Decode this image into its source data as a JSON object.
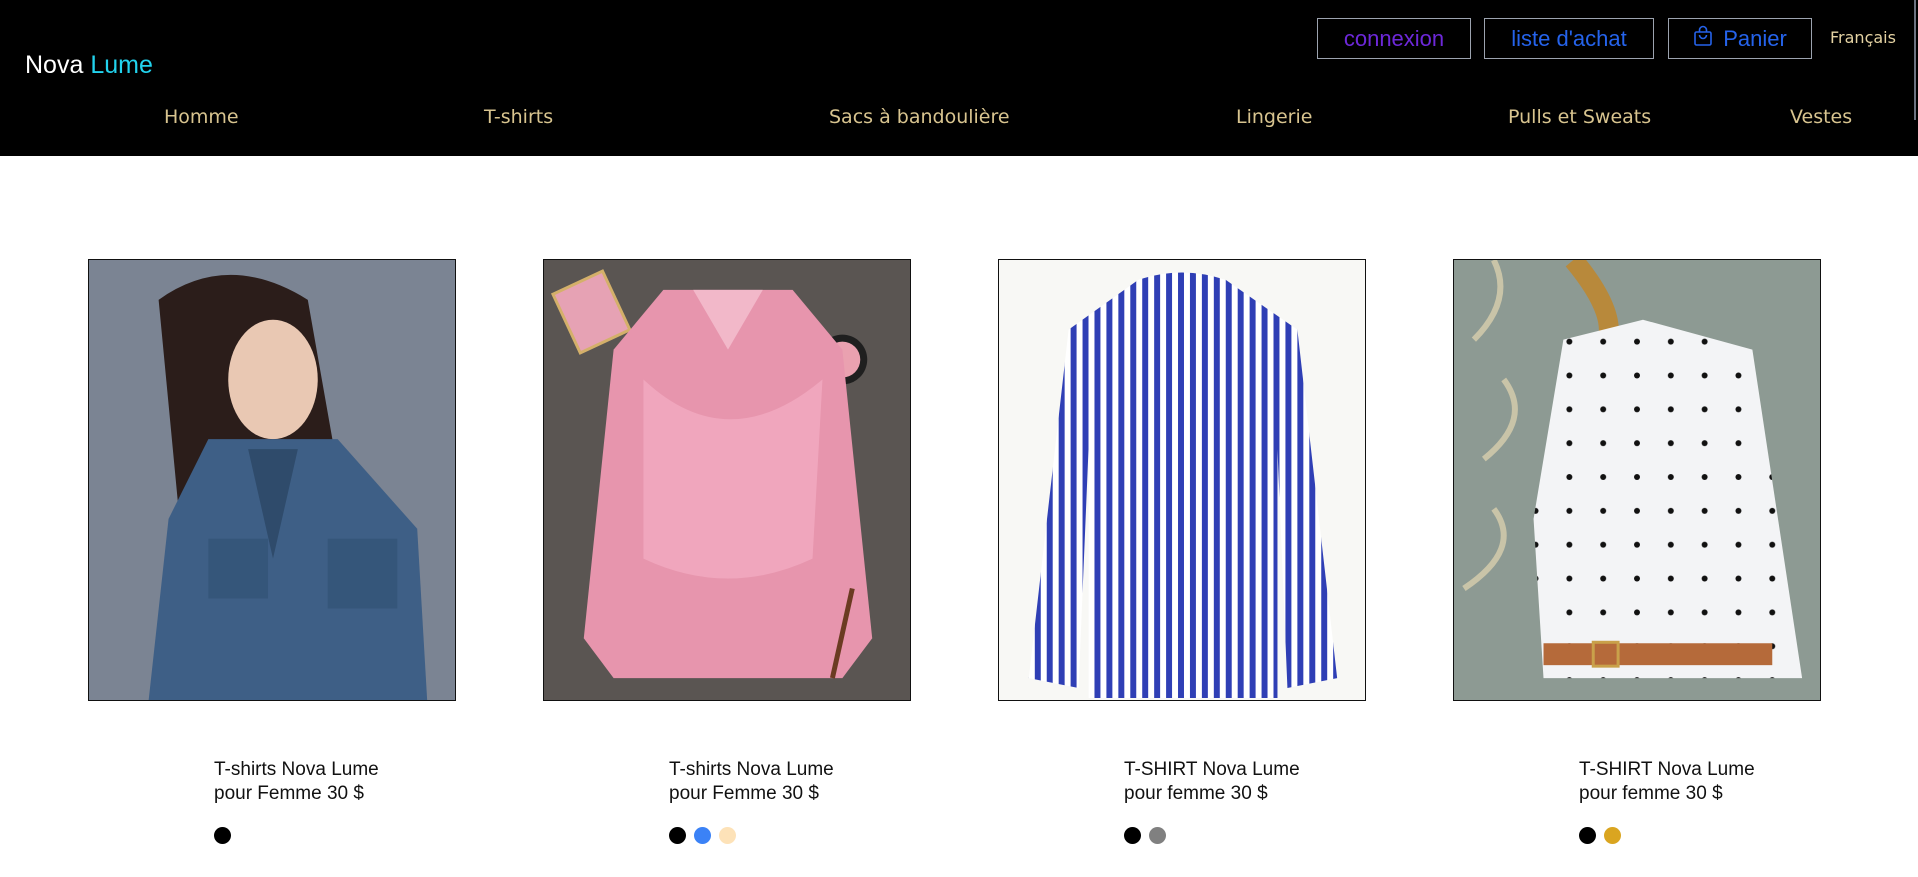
{
  "brand": {
    "first": "Nova",
    "second": "Lume"
  },
  "header_buttons": {
    "login": "connexion",
    "wishlist": "liste d'achat",
    "cart": "Panier"
  },
  "language": "Français",
  "nav": [
    "Homme",
    "T-shirts",
    "Sacs à bandoulière",
    "Lingerie",
    "Pulls et Sweats",
    "Vestes"
  ],
  "products": [
    {
      "title_line1": "T-shirts Nova Lume",
      "title_line2": "pour Femme 30 $",
      "colors": [
        "#000000"
      ]
    },
    {
      "title_line1": "T-shirts Nova Lume",
      "title_line2": "pour Femme 30 $",
      "colors": [
        "#000000",
        "#3b82f6",
        "#fde2b8"
      ]
    },
    {
      "title_line1": "T-SHIRT Nova Lume",
      "title_line2": "pour femme 30 $",
      "colors": [
        "#000000",
        "#808080"
      ]
    },
    {
      "title_line1": "T-SHIRT Nova Lume",
      "title_line2": "pour femme 30 $",
      "colors": [
        "#000000",
        "#daa520"
      ]
    }
  ],
  "icons": {
    "cart": "shopping-bag-icon"
  },
  "colors": {
    "header_bg": "#000000",
    "brand_accent": "#22d3ee",
    "nav_text": "#d8c48f"
  }
}
